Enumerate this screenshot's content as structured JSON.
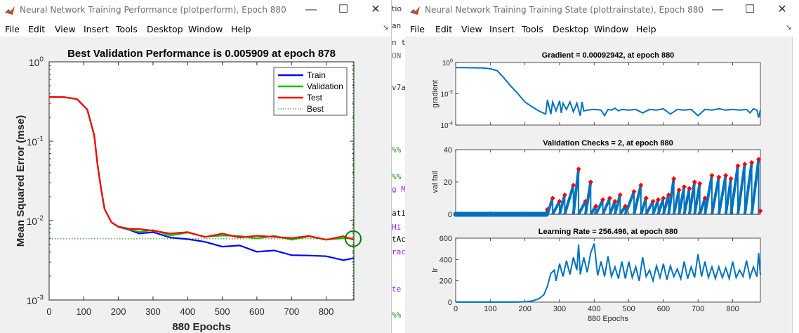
{
  "left_window": {
    "title": "Neural Network Training Performance (plotperform), Epoch 880",
    "menu": [
      "File",
      "Edit",
      "View",
      "Insert",
      "Tools",
      "Desktop",
      "Window",
      "Help"
    ],
    "dock_glyph": "↘",
    "minimize_glyph": "—",
    "maximize_glyph": "☐",
    "close_glyph": "✕"
  },
  "right_window": {
    "title": "Neural Network Training Training State (plottrainstate), Epoch 880",
    "menu": [
      "File",
      "Edit",
      "View",
      "Insert",
      "Tools",
      "Desktop",
      "Window",
      "Help"
    ],
    "dock_glyph": "↘",
    "minimize_glyph": "—",
    "maximize_glyph": "☐",
    "close_glyph": "✕"
  },
  "background_editor_fragments": [
    "tio",
    "an",
    "n to",
    "ON",
    "v7a",
    "%%",
    "%%",
    "g M",
    "ati",
    "Hi",
    "tAc",
    "rac",
    "te",
    "%%"
  ],
  "colors": {
    "train": "#0000ff",
    "validation": "#00c000",
    "test": "#ff0000",
    "best": "#008000",
    "state_line": "#0072bd",
    "state_marker": "#ff0000"
  },
  "chart_data": [
    {
      "type": "line",
      "title": "Best Validation Performance is 0.005909 at epoch 878",
      "xlabel": "880 Epochs",
      "ylabel": "Mean Squared Error  (mse)",
      "yscale": "log",
      "xlim": [
        0,
        880
      ],
      "ylim": [
        0.001,
        1
      ],
      "x_ticks": [
        "0",
        "100",
        "200",
        "300",
        "400",
        "500",
        "600",
        "700",
        "800"
      ],
      "y_ticks": [
        {
          "base": "10",
          "exp": "0"
        },
        {
          "base": "10",
          "exp": "-1"
        },
        {
          "base": "10",
          "exp": "-2"
        },
        {
          "base": "10",
          "exp": "-3"
        }
      ],
      "legend_position": "top-right",
      "legend": [
        "Train",
        "Validation",
        "Test",
        "Best"
      ],
      "best": {
        "epoch": 878,
        "value": 0.005909
      },
      "series": [
        {
          "name": "Train",
          "x": [
            0,
            40,
            80,
            110,
            130,
            140,
            150,
            160,
            180,
            200,
            230,
            260,
            300,
            350,
            400,
            450,
            500,
            550,
            600,
            650,
            700,
            750,
            800,
            850,
            880
          ],
          "y": [
            0.36,
            0.36,
            0.34,
            0.25,
            0.12,
            0.05,
            0.025,
            0.014,
            0.0095,
            0.0083,
            0.0077,
            0.0073,
            0.0068,
            0.0063,
            0.0058,
            0.0053,
            0.0049,
            0.0046,
            0.0043,
            0.004,
            0.0038,
            0.0036,
            0.0035,
            0.0033,
            0.0032
          ]
        },
        {
          "name": "Validation",
          "x": [
            0,
            40,
            80,
            110,
            130,
            140,
            150,
            160,
            180,
            200,
            230,
            260,
            300,
            350,
            400,
            450,
            500,
            550,
            600,
            650,
            700,
            750,
            800,
            850,
            880
          ],
          "y": [
            0.36,
            0.36,
            0.34,
            0.25,
            0.12,
            0.05,
            0.025,
            0.014,
            0.0095,
            0.0083,
            0.0078,
            0.0075,
            0.0072,
            0.0069,
            0.0067,
            0.0065,
            0.0064,
            0.0063,
            0.0062,
            0.0061,
            0.0061,
            0.006,
            0.006,
            0.0059,
            0.0059
          ]
        },
        {
          "name": "Test",
          "x": [
            0,
            40,
            80,
            110,
            130,
            140,
            150,
            160,
            180,
            200,
            230,
            260,
            300,
            350,
            400,
            450,
            500,
            550,
            600,
            650,
            700,
            750,
            800,
            850,
            880
          ],
          "y": [
            0.36,
            0.36,
            0.34,
            0.25,
            0.12,
            0.05,
            0.025,
            0.014,
            0.0095,
            0.0084,
            0.0079,
            0.0077,
            0.0074,
            0.0071,
            0.0068,
            0.0066,
            0.0065,
            0.0064,
            0.0063,
            0.0062,
            0.0062,
            0.0061,
            0.0061,
            0.006,
            0.006
          ]
        }
      ]
    },
    {
      "type": "line",
      "title": "Gradient = 0.00092942, at epoch 880",
      "ylabel": "gradient",
      "yscale": "log",
      "xlim": [
        0,
        880
      ],
      "ylim": [
        0.0001,
        1
      ],
      "y_ticks": [
        {
          "base": "10",
          "exp": "0"
        },
        {
          "base": "10",
          "exp": "-2"
        },
        {
          "base": "10",
          "exp": "-4"
        }
      ],
      "x": [
        0,
        20,
        50,
        80,
        100,
        120,
        140,
        160,
        180,
        200,
        220,
        240,
        260,
        265,
        275,
        280,
        290,
        300,
        305,
        310,
        320,
        330,
        340,
        350,
        360,
        365,
        370,
        380,
        400,
        420,
        430,
        440,
        450,
        460,
        470,
        480,
        500,
        520,
        540,
        560,
        580,
        600,
        620,
        640,
        660,
        680,
        700,
        720,
        740,
        760,
        780,
        800,
        820,
        840,
        850,
        860,
        870,
        875,
        880
      ],
      "y": [
        0.47,
        0.47,
        0.46,
        0.45,
        0.4,
        0.3,
        0.1,
        0.03,
        0.01,
        0.003,
        0.0015,
        0.0008,
        0.0005,
        0.004,
        0.0005,
        0.003,
        0.0008,
        0.0035,
        0.0006,
        0.0025,
        0.001,
        0.003,
        0.0007,
        0.0025,
        0.0004,
        0.003,
        0.0008,
        0.0009,
        0.001,
        0.0009,
        0.0004,
        0.001,
        0.0009,
        0.0012,
        0.0008,
        0.001,
        0.0009,
        0.001,
        0.0006,
        0.001,
        0.0009,
        0.0011,
        0.0005,
        0.001,
        0.0009,
        0.001,
        0.0004,
        0.001,
        0.0009,
        0.0011,
        0.0009,
        0.001,
        0.0009,
        0.001,
        0.0006,
        0.0011,
        0.0009,
        0.0003,
        0.00093
      ]
    },
    {
      "type": "line",
      "title": "Validation Checks = 2, at epoch 880",
      "ylabel": "val fail",
      "xlim": [
        0,
        880
      ],
      "ylim": [
        0,
        40
      ],
      "y_ticks": [
        "0",
        "20",
        "40"
      ],
      "peaks": [
        [
          265,
          3
        ],
        [
          280,
          10
        ],
        [
          300,
          8
        ],
        [
          315,
          12
        ],
        [
          340,
          18
        ],
        [
          355,
          28
        ],
        [
          375,
          8
        ],
        [
          390,
          20
        ],
        [
          405,
          5
        ],
        [
          425,
          9
        ],
        [
          445,
          10
        ],
        [
          460,
          8
        ],
        [
          475,
          12
        ],
        [
          490,
          5
        ],
        [
          515,
          14
        ],
        [
          535,
          18
        ],
        [
          550,
          10
        ],
        [
          570,
          8
        ],
        [
          585,
          9
        ],
        [
          600,
          10
        ],
        [
          615,
          12
        ],
        [
          630,
          22
        ],
        [
          645,
          15
        ],
        [
          660,
          17
        ],
        [
          675,
          16
        ],
        [
          690,
          20
        ],
        [
          705,
          19
        ],
        [
          720,
          10
        ],
        [
          740,
          24
        ],
        [
          760,
          23
        ],
        [
          780,
          24
        ],
        [
          795,
          22
        ],
        [
          815,
          30
        ],
        [
          835,
          31
        ],
        [
          855,
          32
        ],
        [
          875,
          34
        ]
      ],
      "final_value": 2
    },
    {
      "type": "line",
      "title": "Learning Rate = 256.496, at epoch 880",
      "ylabel": "lr",
      "xlabel": "880 Epochs",
      "xlim": [
        0,
        880
      ],
      "ylim": [
        0,
        600
      ],
      "x_ticks": [
        "0",
        "100",
        "200",
        "300",
        "400",
        "500",
        "600",
        "700",
        "800"
      ],
      "y_ticks": [
        "0",
        "200",
        "400",
        "600"
      ],
      "x": [
        0,
        100,
        150,
        180,
        200,
        220,
        240,
        255,
        265,
        275,
        285,
        290,
        300,
        310,
        320,
        330,
        340,
        350,
        355,
        360,
        370,
        380,
        390,
        400,
        410,
        420,
        430,
        440,
        450,
        460,
        470,
        480,
        490,
        500,
        510,
        520,
        530,
        540,
        550,
        560,
        570,
        580,
        590,
        600,
        610,
        620,
        630,
        640,
        650,
        660,
        670,
        680,
        690,
        700,
        710,
        720,
        730,
        740,
        750,
        760,
        770,
        780,
        790,
        800,
        810,
        820,
        830,
        840,
        850,
        860,
        870,
        875,
        880
      ],
      "y": [
        0.01,
        0.02,
        0.1,
        0.5,
        3,
        10,
        30,
        70,
        150,
        270,
        300,
        200,
        360,
        240,
        390,
        260,
        420,
        300,
        540,
        260,
        420,
        280,
        460,
        550,
        250,
        380,
        240,
        430,
        240,
        330,
        220,
        380,
        220,
        380,
        230,
        330,
        200,
        420,
        240,
        300,
        200,
        340,
        230,
        360,
        210,
        340,
        240,
        310,
        220,
        380,
        220,
        330,
        230,
        450,
        240,
        380,
        230,
        330,
        220,
        330,
        230,
        320,
        220,
        380,
        230,
        300,
        240,
        390,
        230,
        330,
        240,
        460,
        256
      ]
    }
  ]
}
